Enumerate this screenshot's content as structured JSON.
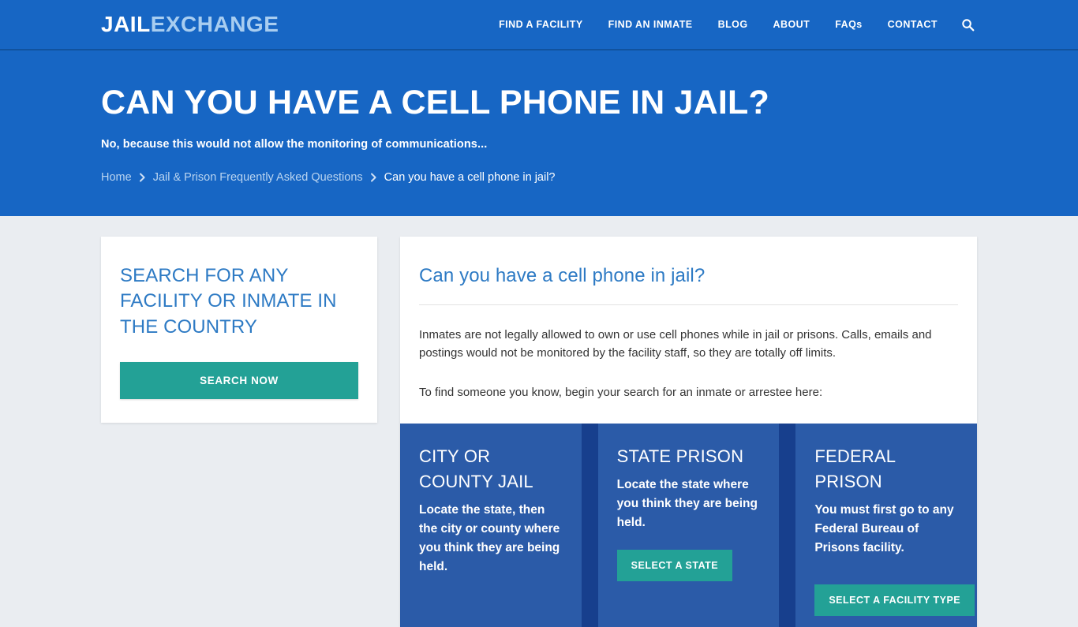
{
  "site": {
    "logo_primary": "JAIL",
    "logo_secondary": "EXCHANGE"
  },
  "nav": {
    "items": [
      {
        "label": "FIND A FACILITY",
        "name": "nav-find-a-facility"
      },
      {
        "label": "FIND AN INMATE",
        "name": "nav-find-an-inmate"
      },
      {
        "label": "BLOG",
        "name": "nav-blog"
      },
      {
        "label": "ABOUT",
        "name": "nav-about"
      },
      {
        "label": "FAQs",
        "name": "nav-faqs"
      },
      {
        "label": "CONTACT",
        "name": "nav-contact"
      }
    ],
    "search_icon": "search-icon"
  },
  "hero": {
    "title": "CAN YOU HAVE A CELL PHONE IN JAIL?",
    "subtitle": "No, because this would not allow the monitoring of communications...",
    "breadcrumb": [
      {
        "label": "Home",
        "current": false
      },
      {
        "label": "Jail & Prison Frequently Asked Questions",
        "current": false
      },
      {
        "label": "Can you have a cell phone in jail?",
        "current": true
      }
    ],
    "breadcrumb_separator": "›"
  },
  "sidebar": {
    "title": "SEARCH FOR ANY FACILITY OR INMATE IN THE COUNTRY",
    "button_label": "SEARCH NOW"
  },
  "main": {
    "title": "Can you have a cell phone in jail?",
    "paragraph_1": "Inmates are not legally allowed to own or use cell phones while in jail or prisons. Calls, emails and postings would not be monitored by the facility staff, so they are totally off limits.",
    "paragraph_2": "To find someone you know, begin your search for an inmate or arrestee here:",
    "option_cards": [
      {
        "title": "CITY OR COUNTY JAIL",
        "description": "Locate the state, then the city or county where you think they are being held.",
        "button_label": ""
      },
      {
        "title": "STATE PRISON",
        "description": "Locate the state where you think they are being held.",
        "button_label": "SELECT A STATE"
      },
      {
        "title": "FEDERAL PRISON",
        "description": "You must first go to any Federal Bureau of Prisons facility.",
        "button_label": "SELECT A FACILITY TYPE"
      }
    ]
  },
  "colors": {
    "brand_blue": "#1766c4",
    "hero_blue": "#1766c4",
    "card_blue": "#2b5ba8",
    "cards_backdrop": "#173f8d",
    "teal": "#23a196",
    "link_blue": "#2d7ac4",
    "page_bg": "#eaedf1",
    "logo_secondary": "#a8cdf0"
  }
}
